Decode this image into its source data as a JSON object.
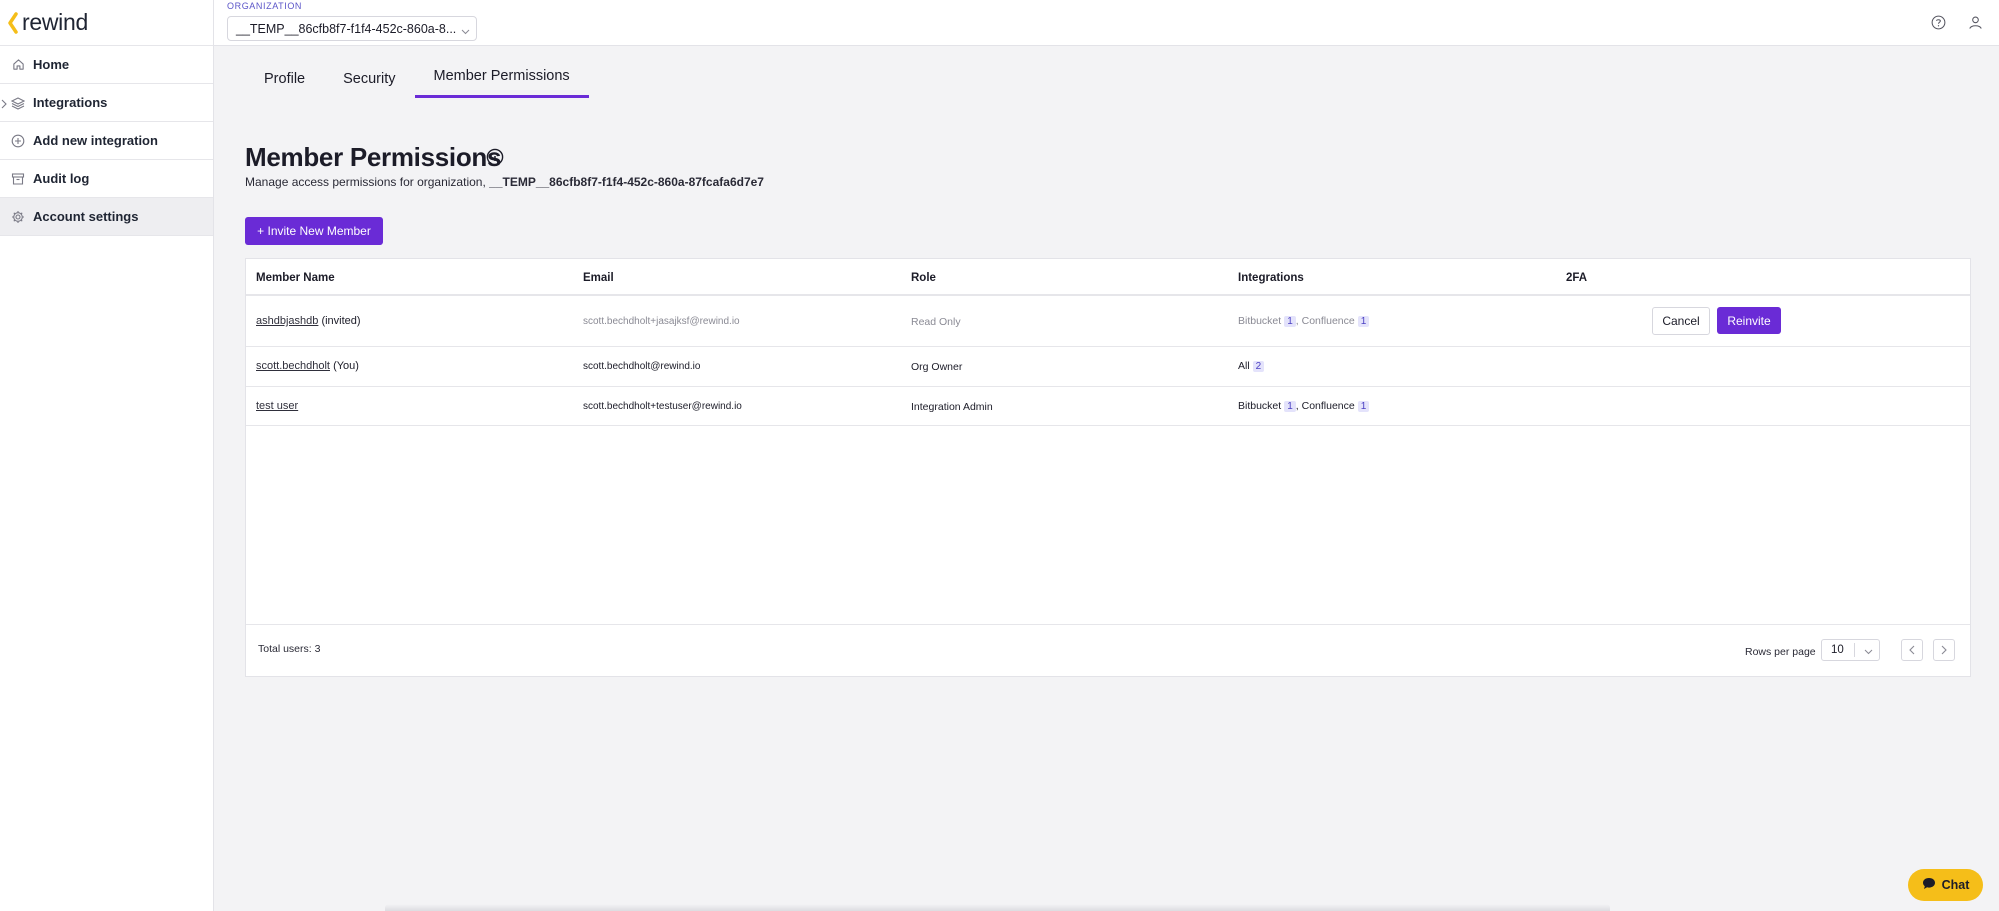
{
  "brand": {
    "name": "rewind",
    "accent_color": "#f5be19"
  },
  "sidebar": {
    "items": [
      {
        "label": "Home",
        "icon": "home-icon"
      },
      {
        "label": "Integrations",
        "icon": "layers-icon"
      },
      {
        "label": "Add new integration",
        "icon": "plus-circle-icon"
      },
      {
        "label": "Audit log",
        "icon": "archive-icon"
      },
      {
        "label": "Account settings",
        "icon": "gear-icon",
        "active": true
      }
    ]
  },
  "topbar": {
    "org_label": "ORGANIZATION",
    "org_value": "__TEMP__86cfb8f7-f1f4-452c-860a-8...",
    "icons": [
      "help-icon",
      "user-icon"
    ]
  },
  "tabs": [
    "Profile",
    "Security",
    "Member Permissions"
  ],
  "active_tab": "Member Permissions",
  "page": {
    "title": "Member Permissions",
    "subtitle_prefix": "Manage access permissions for organization,",
    "org_full": "__TEMP__86cfb8f7-f1f4-452c-860a-87fcafa6d7e7",
    "invite_button": "+ Invite New Member"
  },
  "table": {
    "headers": [
      "Member Name",
      "Email",
      "Role",
      "Integrations",
      "2FA"
    ],
    "rows": [
      {
        "name": "ashdbjashdb",
        "suffix": "(invited)",
        "email": "scott.bechdholt+jasajksf@rewind.io",
        "role": "Read Only",
        "integrations": [
          {
            "name": "Bitbucket",
            "count": "1"
          },
          {
            "name": "Confluence",
            "count": "1"
          }
        ],
        "actions": {
          "cancel": "Cancel",
          "reinvite": "Reinvite"
        },
        "muted": true
      },
      {
        "name": "scott.bechdholt",
        "suffix": "(You)",
        "email": "scott.bechdholt@rewind.io",
        "role": "Org Owner",
        "integrations": [
          {
            "name": "All",
            "count": "2"
          }
        ]
      },
      {
        "name": "test user",
        "suffix": "",
        "email": "scott.bechdholt+testuser@rewind.io",
        "role": "Integration Admin",
        "integrations": [
          {
            "name": "Bitbucket",
            "count": "1"
          },
          {
            "name": "Confluence",
            "count": "1"
          }
        ]
      }
    ],
    "footer": {
      "total": "Total users: 3",
      "rows_per_page_label": "Rows per page",
      "rows_per_page_value": "10"
    }
  },
  "chat": {
    "label": "Chat"
  },
  "colors": {
    "primary": "#6a2bd6",
    "badge_bg": "#e4e3fb"
  }
}
